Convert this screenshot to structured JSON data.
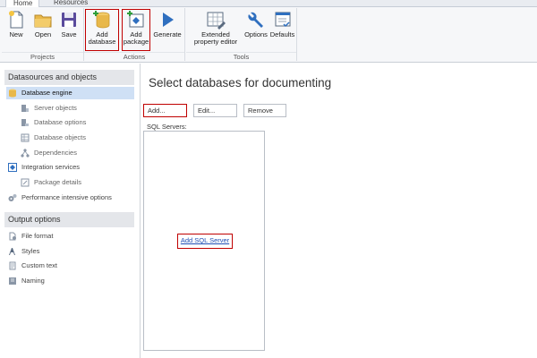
{
  "tabs": [
    "Home",
    "Resources"
  ],
  "ribbon": {
    "groups": [
      {
        "label": "Projects",
        "buttons": [
          "New",
          "Open",
          "Save"
        ]
      },
      {
        "label": "Actions",
        "buttons": [
          "Add database",
          "Add package",
          "Generate"
        ]
      },
      {
        "label": "Tools",
        "buttons": [
          "Extended property editor",
          "Options",
          "Defaults"
        ]
      }
    ],
    "new_label": "New",
    "open_label": "Open",
    "save_label": "Save",
    "add_database_l1": "Add",
    "add_database_l2": "database",
    "add_package_l1": "Add",
    "add_package_l2": "package",
    "generate_label": "Generate",
    "ext_prop_l1": "Extended",
    "ext_prop_l2": "property editor",
    "options_label": "Options",
    "defaults_label": "Defaults",
    "projects_group": "Projects",
    "actions_group": "Actions",
    "tools_group": "Tools"
  },
  "sidebar": {
    "section1": "Datasources and objects",
    "section2": "Output options",
    "items": [
      {
        "label": "Database engine",
        "icon": "database-icon"
      },
      {
        "label": "Server objects",
        "icon": "server-objects-icon"
      },
      {
        "label": "Database options",
        "icon": "database-options-icon"
      },
      {
        "label": "Database objects",
        "icon": "database-objects-icon"
      },
      {
        "label": "Dependencies",
        "icon": "dependencies-icon"
      },
      {
        "label": "Integration services",
        "icon": "integration-services-icon"
      },
      {
        "label": "Package details",
        "icon": "package-details-icon"
      },
      {
        "label": "Performance intensive options",
        "icon": "performance-icon"
      },
      {
        "label": "File format",
        "icon": "file-format-icon"
      },
      {
        "label": "Styles",
        "icon": "styles-icon"
      },
      {
        "label": "Custom text",
        "icon": "custom-text-icon"
      },
      {
        "label": "Naming",
        "icon": "naming-icon"
      }
    ]
  },
  "main": {
    "title": "Select databases for documenting",
    "add_button": "Add...",
    "edit_button": "Edit...",
    "remove_button": "Remove",
    "servers_label": "SQL Servers:",
    "add_sql_server_link": "Add SQL Server"
  },
  "colors": {
    "highlight": "#c00000",
    "selected_bg": "#cfe0f5",
    "link": "#1f4fb5",
    "accent_blue": "#2f6fbf",
    "folder": "#e8b84a"
  }
}
